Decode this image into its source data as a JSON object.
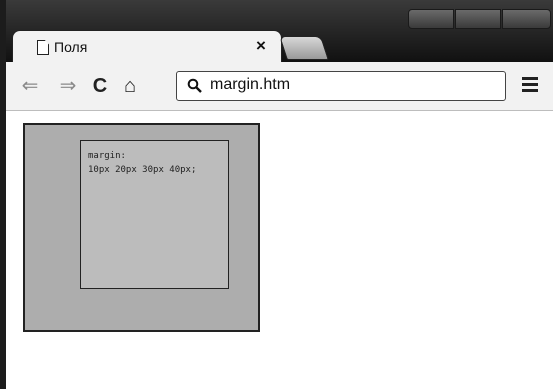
{
  "tab": {
    "title": "Поля",
    "close_glyph": "×"
  },
  "toolbar": {
    "back_glyph": "⇐",
    "forward_glyph": "⇒",
    "reload_glyph": "C",
    "home_glyph": "⌂"
  },
  "omnibox": {
    "url": "margin.htm"
  },
  "page": {
    "box_label_line1": "margin:",
    "box_label_line2": "10px 20px 30px 40px;"
  },
  "colors": {
    "outer_box": "#adadad",
    "inner_box": "#bcbcbc",
    "titlebar": "#1a1a1a"
  },
  "icons": [
    "document-icon",
    "close-icon",
    "back-arrow-icon",
    "forward-arrow-icon",
    "reload-icon",
    "home-icon",
    "search-icon",
    "menu-icon"
  ]
}
